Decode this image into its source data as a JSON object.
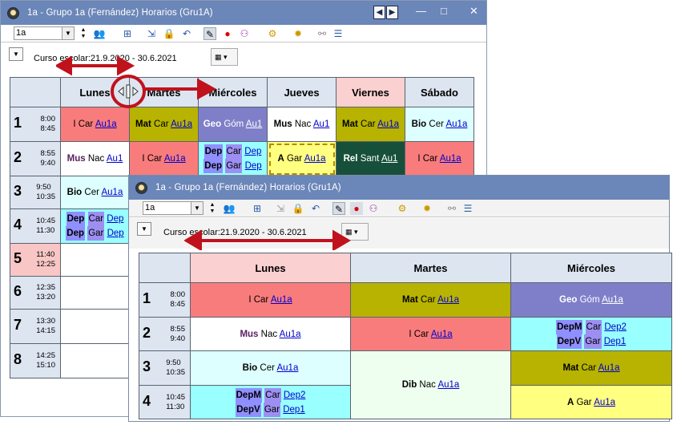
{
  "colors": {
    "title_bar": "#6b86b8",
    "header_bg": "#dde5f1",
    "viernes_bg": "#fbd0d0",
    "red": "#f97c7c",
    "olive": "#b7b300",
    "purple": "#7f7fc9",
    "cyan": "#9ff",
    "lightcyan": "#dff",
    "yellow": "#ffff80",
    "darkgreen": "#17503a",
    "pink_period": "#f9c6c6",
    "arrow_red": "#c0121c"
  },
  "back": {
    "title": "1a - Grupo 1a (Fernández)  Horarios  (Gru1A)",
    "class_select": "1a",
    "curso": "Curso escolar:21.9.2020 - 30.6.2021",
    "days": [
      "Lunes",
      "Martes",
      "Miércoles",
      "Jueves",
      "Viernes",
      "Sábado"
    ],
    "periods": [
      {
        "n": "1",
        "start": "8:00",
        "end": "8:45"
      },
      {
        "n": "2",
        "start": "8:55",
        "end": "9:40"
      },
      {
        "n": "3",
        "start": "9:50",
        "end": "10:35"
      },
      {
        "n": "4",
        "start": "10:45",
        "end": "11:30"
      },
      {
        "n": "5",
        "start": "11:40",
        "end": "12:25"
      },
      {
        "n": "6",
        "start": "12:35",
        "end": "13:20"
      },
      {
        "n": "7",
        "start": "13:30",
        "end": "14:15"
      },
      {
        "n": "8",
        "start": "14:25",
        "end": "15:10"
      }
    ],
    "r1": {
      "lun": {
        "s": "I",
        "t": "Car",
        "r": "Au1a"
      },
      "mar": {
        "s": "Mat",
        "t": "Car",
        "r": "Au1a"
      },
      "mie": {
        "s": "Geo",
        "t": "Góm",
        "r": "Au1"
      },
      "jue": {
        "s": "Mus",
        "t": "Nac",
        "r": "Au1"
      },
      "vie": {
        "s": "Mat",
        "t": "Car",
        "r": "Au1a"
      },
      "sab": {
        "s": "Bio",
        "t": "Cer",
        "r": "Au1a"
      }
    },
    "r2": {
      "lun": {
        "s": "Mus",
        "t": "Nac",
        "r": "Au1"
      },
      "mar": {
        "s": "I",
        "t": "Car",
        "r": "Au1a"
      },
      "mie1": {
        "s": "Dep",
        "t": "Car",
        "r": "Dep"
      },
      "mie2": {
        "s": "Dep",
        "t": "Gar",
        "r": "Dep"
      },
      "jue": {
        "s": "A",
        "t": "Gar",
        "r": "Au1a"
      },
      "vie": {
        "s": "Rel",
        "t": "Sant",
        "r": "Au1"
      },
      "sab": {
        "s": "I",
        "t": "Car",
        "r": "Au1a"
      }
    },
    "r3": {
      "lun": {
        "s": "Bio",
        "t": "Cer",
        "r": "Au1a"
      }
    },
    "r4": {
      "lun1": {
        "s": "Dep",
        "t": "Car",
        "r": "Dep"
      },
      "lun2": {
        "s": "Dep",
        "t": "Gar",
        "r": "Dep"
      }
    }
  },
  "front": {
    "title": "1a - Grupo 1a (Fernández)  Horarios  (Gru1A)",
    "class_select": "1a",
    "curso": "Curso escolar:21.9.2020 - 30.6.2021",
    "days": [
      "Lunes",
      "Martes",
      "Miércoles"
    ],
    "periods": [
      {
        "n": "1",
        "start": "8:00",
        "end": "8:45"
      },
      {
        "n": "2",
        "start": "8:55",
        "end": "9:40"
      },
      {
        "n": "3",
        "start": "9:50",
        "end": "10:35"
      },
      {
        "n": "4",
        "start": "10:45",
        "end": "11:30"
      }
    ],
    "r1": {
      "lun": {
        "s": "I",
        "t": "Car",
        "r": "Au1a"
      },
      "mar": {
        "s": "Mat",
        "t": "Car",
        "r": "Au1a"
      },
      "mie": {
        "s": "Geo",
        "t": "Góm",
        "r": "Au1a"
      }
    },
    "r2": {
      "lun": {
        "s": "Mus",
        "t": "Nac",
        "r": "Au1a"
      },
      "mar": {
        "s": "I",
        "t": "Car",
        "r": "Au1a"
      },
      "mie1": {
        "s": "DepM",
        "t": "Car",
        "r": "Dep2"
      },
      "mie2": {
        "s": "DepV",
        "t": "Gar",
        "r": "Dep1"
      }
    },
    "r3": {
      "lun": {
        "s": "Bio",
        "t": "Cer",
        "r": "Au1a"
      },
      "mar": {
        "s": "Dib",
        "t": "Nac",
        "r": "Au1a"
      },
      "mie": {
        "s": "Mat",
        "t": "Car",
        "r": "Au1a"
      }
    },
    "r4": {
      "lun1": {
        "s": "DepM",
        "t": "Car",
        "r": "Dep2"
      },
      "lun2": {
        "s": "DepV",
        "t": "Gar",
        "r": "Dep1"
      },
      "mie": {
        "s": "A",
        "t": "Gar",
        "r": "Au1a"
      }
    }
  }
}
